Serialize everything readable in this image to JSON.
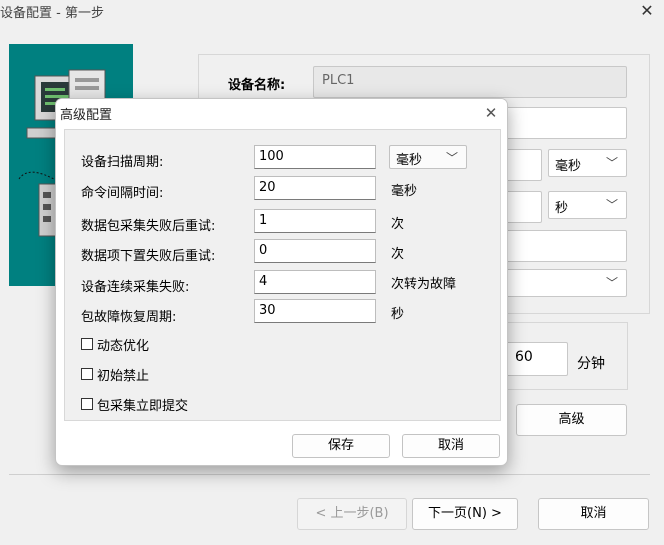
{
  "window": {
    "title": "设备配置 - 第一步",
    "close_glyph": "✕"
  },
  "background_form": {
    "device_name_label": "设备名称:",
    "device_name_value": "PLC1",
    "unit_ms": "毫秒",
    "unit_s": "秒",
    "interval_value": "60",
    "interval_unit": "分钟",
    "advanced_button": "高级"
  },
  "footer": {
    "prev_button": "< 上一步(B)",
    "next_button": "下一页(N) >",
    "cancel_button": "取消"
  },
  "dialog": {
    "title": "高级配置",
    "close_glyph": "✕",
    "fields": [
      {
        "label": "设备扫描周期:",
        "value": "100",
        "unit": "毫秒",
        "unit_is_select": true
      },
      {
        "label": "命令间隔时间:",
        "value": "20",
        "unit": "毫秒"
      },
      {
        "label": "数据包采集失败后重试:",
        "value": "1",
        "unit": "次"
      },
      {
        "label": "数据项下置失败后重试:",
        "value": "0",
        "unit": "次"
      },
      {
        "label": "设备连续采集失败:",
        "value": "4",
        "unit": "次转为故障"
      },
      {
        "label": "包故障恢复周期:",
        "value": "30",
        "unit": "秒"
      }
    ],
    "checkboxes": [
      {
        "label": "动态优化",
        "checked": false
      },
      {
        "label": "初始禁止",
        "checked": false
      },
      {
        "label": "包采集立即提交",
        "checked": false
      }
    ],
    "save_button": "保存",
    "cancel_button": "取消"
  },
  "colors": {
    "wizard_image_bg": "#008080"
  }
}
